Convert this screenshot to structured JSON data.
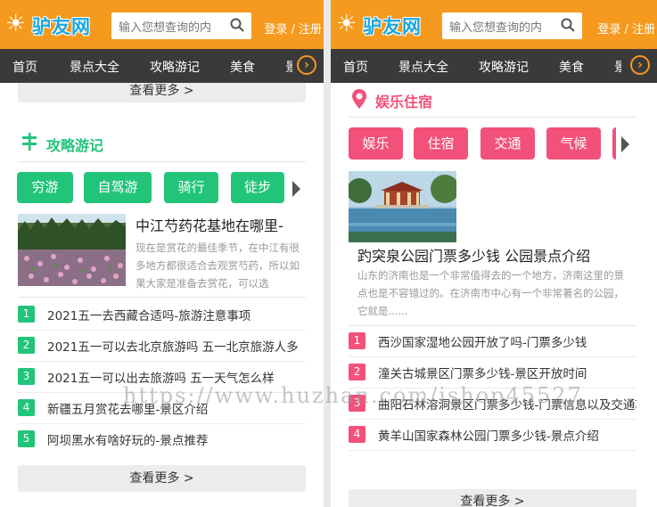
{
  "colors": {
    "header": "#f59a1e",
    "nav": "#3a3a3a",
    "green": "#22c47a",
    "pink": "#f2517a",
    "brand": "#1aa7e0"
  },
  "header": {
    "brand": "驴友网",
    "search_placeholder": "输入您想查询的内",
    "login": "登录 / 注册"
  },
  "nav": {
    "items": [
      "首页",
      "景点大全",
      "攻略游记",
      "美食",
      "景"
    ],
    "arrow_icon": "circle-arrow-right-icon"
  },
  "left": {
    "more_top": "查看更多 >",
    "section_title": "攻略游记",
    "section_icon": "signpost-icon",
    "categories": [
      "穷游",
      "自驾游",
      "骑行",
      "徒步"
    ],
    "article": {
      "title": "中江芍药花基地在哪里-",
      "desc": "现在是赏花的最佳季节，在中江有很多地方都很适合去观赏芍药，所以如果大家是准备去赏花，可以选"
    },
    "list": [
      {
        "num": "1",
        "text": "2021五一去西藏合适吗-旅游注意事项"
      },
      {
        "num": "2",
        "text": "2021五一可以去北京旅游吗 五一北京旅游人多"
      },
      {
        "num": "3",
        "text": "2021五一可以出去旅游吗 五一天气怎么样"
      },
      {
        "num": "4",
        "text": "新疆五月赏花去哪里-景区介绍"
      },
      {
        "num": "5",
        "text": "阿坝黑水有啥好玩的-景点推荐"
      }
    ],
    "more_bottom": "查看更多 >"
  },
  "right": {
    "section_title": "娱乐住宿",
    "section_icon": "map-pin-icon",
    "categories": [
      "娱乐",
      "住宿",
      "交通",
      "气候"
    ],
    "article": {
      "title": "趵突泉公园门票多少钱 公园景点介绍",
      "desc": "山东的济南也是一个非常值得去的一个地方，济南这里的景点也是不容错过的。在济南市中心有一个非常著名的公园，它就是......"
    },
    "list": [
      {
        "num": "1",
        "text": "西沙国家湿地公园开放了吗-门票多少钱"
      },
      {
        "num": "2",
        "text": "潼关古城景区门票多少钱-景区开放时间"
      },
      {
        "num": "3",
        "text": "曲阳石林溶洞景区门票多少钱-门票信息以及交通攻"
      },
      {
        "num": "4",
        "text": "黄羊山国家森林公园门票多少钱-景点介绍"
      }
    ],
    "more_bottom": "查看更多 >"
  },
  "watermark": "https://www.huzhan.com/ishop45527"
}
